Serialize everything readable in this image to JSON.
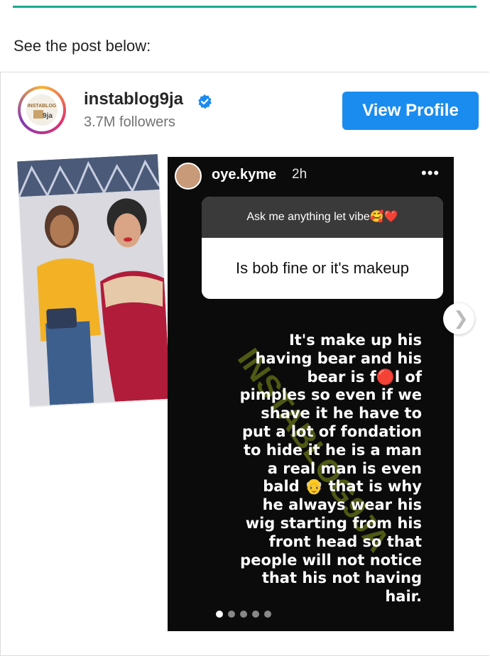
{
  "intro_text": "See the post below:",
  "profile": {
    "username": "instablog9ja",
    "followers": "3.7M followers",
    "view_profile_label": "View Profile",
    "logo_text": "INSTABLOG",
    "logo_suffix": "9ja"
  },
  "story": {
    "username": "oye.kyme",
    "time": "2h",
    "more_label": "•••",
    "question_prompt": "Ask me anything let vibe🥰❤️",
    "question": "Is bob fine or it's makeup",
    "answer": "It's make up his\nhaving bear and his\nbear is f🔴l of\npimples so even if we\nshave it he have to\nput a lot of fondation\nto hide it he is a man\na real man is even\nbald 👴 that is why\nhe always wear his\nwig starting from his\nfront head so that\npeople will not notice\nthat his not having\nhair.",
    "watermark": "INSTABLOG9JA",
    "slide_count": 5,
    "active_slide": 1
  },
  "colors": {
    "accent_rule": "#19a88c",
    "button": "#1a8cf0",
    "verified": "#1a8cf0"
  },
  "icons": {
    "verified": "verified-badge-icon",
    "next": "chevron-right-icon"
  }
}
